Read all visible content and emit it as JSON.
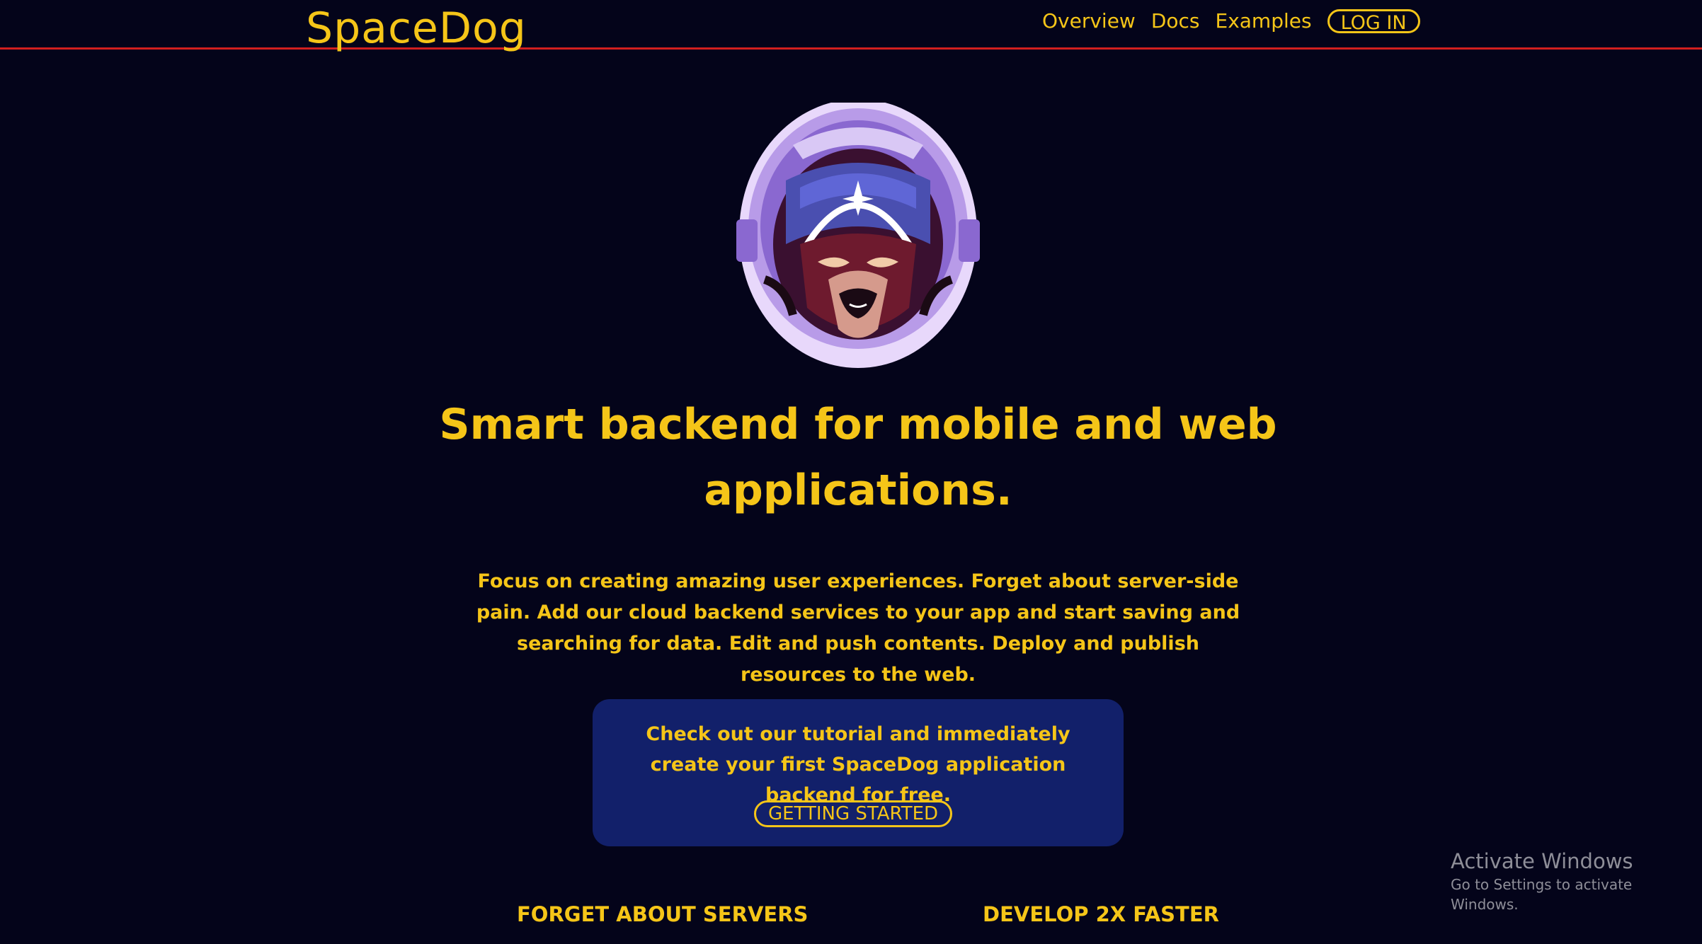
{
  "header": {
    "brand": "SpaceDog",
    "nav": [
      {
        "label": "Overview"
      },
      {
        "label": "Docs"
      },
      {
        "label": "Examples"
      }
    ],
    "login_label": "LOG IN"
  },
  "hero": {
    "mascot_icon": "astronaut-dog-icon",
    "headline": "Smart backend for mobile and web applications.",
    "intro": "Focus on creating amazing user experiences. Forget about server-side pain. Add our cloud backend services to your app and start saving and searching for data. Edit and push contents. Deploy and publish resources to the web."
  },
  "cta": {
    "text": "Check out our tutorial and immediately create your first SpaceDog application backend for free.",
    "button_label": "GETTING STARTED"
  },
  "features": [
    {
      "title": "FORGET ABOUT SERVERS"
    },
    {
      "title": "DEVELOP 2X FASTER"
    }
  ],
  "watermark": {
    "title": "Activate Windows",
    "subtitle": "Go to Settings to activate Windows."
  },
  "colors": {
    "background": "#04041a",
    "accent": "#f5c518",
    "divider": "#d21f1f",
    "card": "#12206a"
  }
}
